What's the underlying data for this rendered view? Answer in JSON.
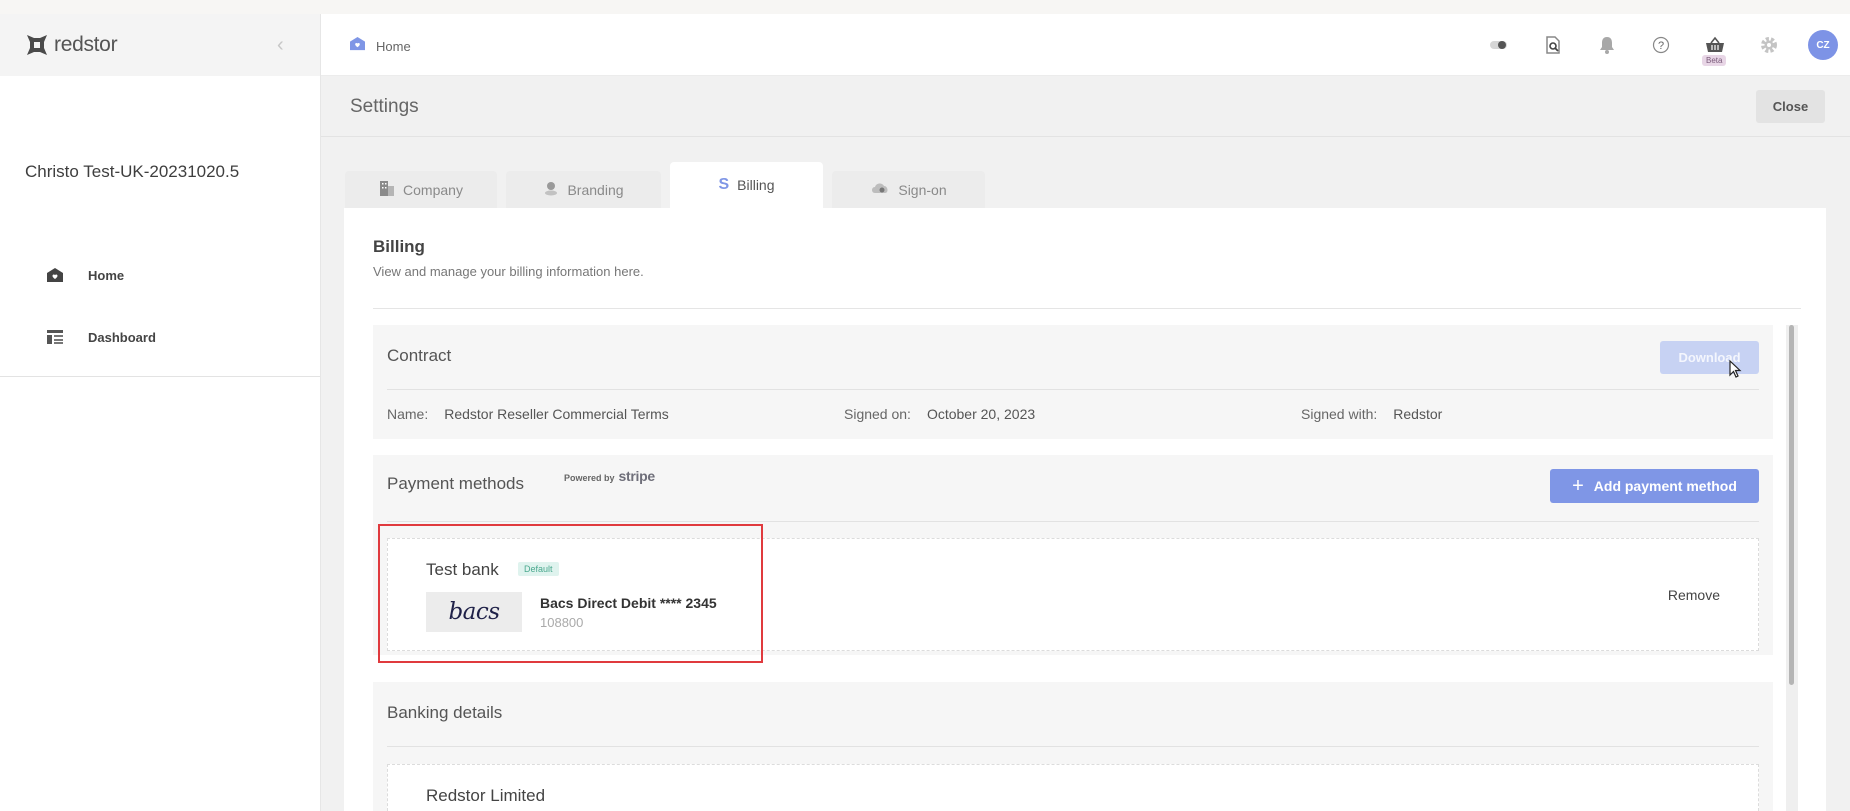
{
  "app": {
    "logo_text": "redstor",
    "org_name": "Christo Test-UK-20231020.5"
  },
  "sidebar": {
    "items": [
      {
        "label": "Home",
        "icon": "home-icon"
      },
      {
        "label": "Dashboard",
        "icon": "dashboard-icon"
      }
    ]
  },
  "header": {
    "breadcrumb": "Home",
    "icons": [
      "toggle-icon",
      "search-document-icon",
      "bell-icon",
      "help-icon",
      "basket-icon",
      "gear-icon"
    ],
    "beta_label": "Beta",
    "avatar_initials": "CZ"
  },
  "settings": {
    "title": "Settings",
    "close_label": "Close"
  },
  "tabs": [
    {
      "label": "Company",
      "icon": "building-icon"
    },
    {
      "label": "Branding",
      "icon": "palette-icon"
    },
    {
      "label": "Billing",
      "icon": "stripe-s-icon",
      "active": true
    },
    {
      "label": "Sign-on",
      "icon": "cloud-icon"
    }
  ],
  "billing": {
    "title": "Billing",
    "subtitle": "View and manage your billing information here."
  },
  "contract": {
    "title": "Contract",
    "download_label": "Download",
    "name_label": "Name:",
    "name_value": "Redstor Reseller Commercial Terms",
    "signed_on_label": "Signed on:",
    "signed_on_value": "October 20, 2023",
    "signed_with_label": "Signed with:",
    "signed_with_value": "Redstor"
  },
  "payments": {
    "title": "Payment methods",
    "powered_by": "Powered by",
    "stripe": "stripe",
    "add_label": "Add payment method",
    "method": {
      "name": "Test bank",
      "badge": "Default",
      "logo_text": "bacs",
      "description": "Bacs Direct Debit **** 2345",
      "sort_code": "108800",
      "remove_label": "Remove"
    }
  },
  "banking": {
    "title": "Banking details",
    "company": "Redstor Limited"
  },
  "colors": {
    "accent": "#7f96e6",
    "highlight": "#e03a3e",
    "avatar": "#7d93e6"
  }
}
